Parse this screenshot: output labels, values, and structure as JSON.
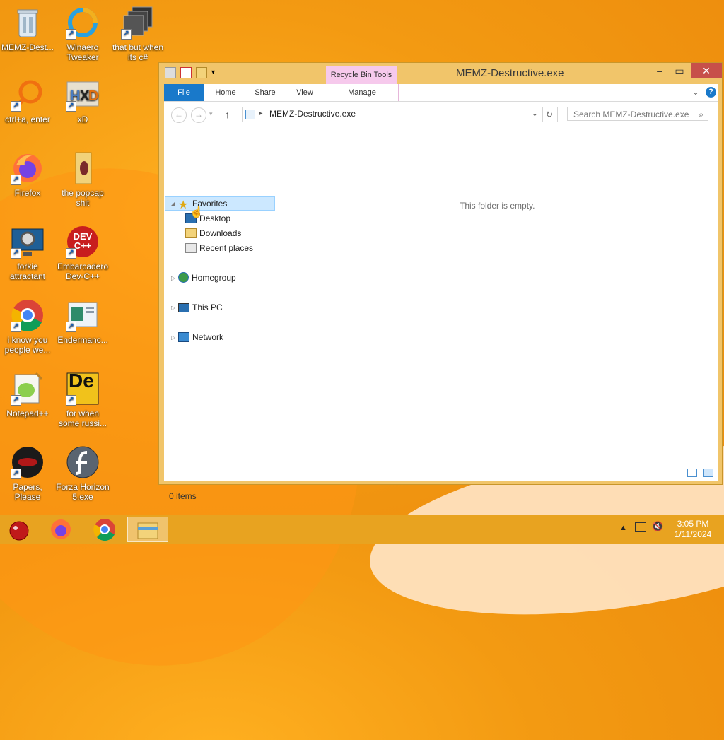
{
  "desktop": {
    "icons": [
      {
        "label": "MEMZ-Dest..."
      },
      {
        "label": "Winaero Tweaker"
      },
      {
        "label": "that but when its c#"
      },
      {
        "label": "ctrl+a, enter"
      },
      {
        "label": "xD"
      },
      {
        "label": "Firefox"
      },
      {
        "label": "the popcap shit"
      },
      {
        "label": "forkie attractant"
      },
      {
        "label": "Embarcadero Dev-C++"
      },
      {
        "label": "i know you people we..."
      },
      {
        "label": "Endermanc..."
      },
      {
        "label": "Notepad++"
      },
      {
        "label": "for when some russi..."
      },
      {
        "label": "Papers, Please"
      },
      {
        "label": "Forza Horizon 5.exe"
      }
    ],
    "dev_text": "DEV C++",
    "de_text": "De"
  },
  "window": {
    "title": "MEMZ-Destructive.exe",
    "context_tab": "Recycle Bin Tools",
    "ribbon_tabs": [
      "File",
      "Home",
      "Share",
      "View",
      "Manage"
    ],
    "address_path": "MEMZ-Destructive.exe",
    "search_placeholder": "Search MEMZ-Destructive.exe",
    "nav": {
      "favorites": "Favorites",
      "desktop": "Desktop",
      "downloads": "Downloads",
      "recent": "Recent places",
      "homegroup": "Homegroup",
      "this_pc": "This PC",
      "network": "Network"
    },
    "empty_message": "This folder is empty.",
    "status": "0 items"
  },
  "taskbar": {
    "time": "3:05 PM",
    "date": "1/11/2024"
  },
  "colors": {
    "accent": "#1979ca",
    "desktop_bg": "#f39a12",
    "window_frame": "#f1c56a",
    "close_button": "#c7504a",
    "context_tab": "#f6c9ec"
  }
}
